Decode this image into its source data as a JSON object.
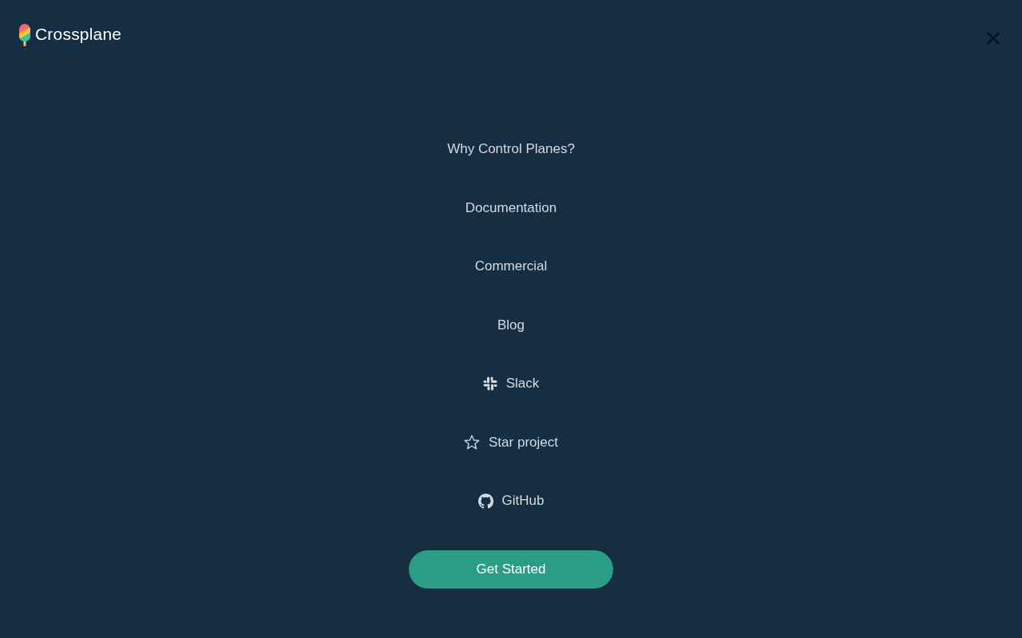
{
  "header": {
    "brand": "Crossplane"
  },
  "menu": [
    {
      "label": "Why Control Planes?",
      "kind": "text"
    },
    {
      "label": "Documentation",
      "kind": "text"
    },
    {
      "label": "Commercial",
      "kind": "text"
    },
    {
      "label": "Blog",
      "kind": "text"
    },
    {
      "label": "Slack",
      "kind": "icon"
    },
    {
      "label": "Star project",
      "kind": "icon"
    },
    {
      "label": "GitHub",
      "kind": "icon"
    }
  ],
  "cta": {
    "label": "Get Started"
  }
}
